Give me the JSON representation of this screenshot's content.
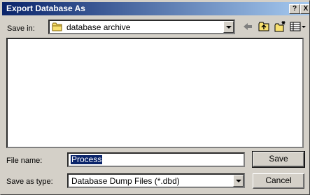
{
  "window": {
    "title": "Export Database As",
    "help_label": "?",
    "close_label": "X"
  },
  "save_in": {
    "label": "Save in:",
    "value": "database archive",
    "icon": "folder-icon"
  },
  "toolbar": {
    "icons": [
      "back-arrow-icon",
      "up-folder-icon",
      "new-folder-icon",
      "view-menu-icon"
    ]
  },
  "file_name": {
    "label": "File name:",
    "value": "Process"
  },
  "save_as_type": {
    "label": "Save as type:",
    "value": "Database Dump Files (*.dbd)"
  },
  "buttons": {
    "save": "Save",
    "cancel": "Cancel"
  },
  "colors": {
    "title_gradient_start": "#0a246a",
    "title_gradient_end": "#a6caf0",
    "dialog_bg": "#d4d0c8",
    "selection": "#0a246a"
  }
}
